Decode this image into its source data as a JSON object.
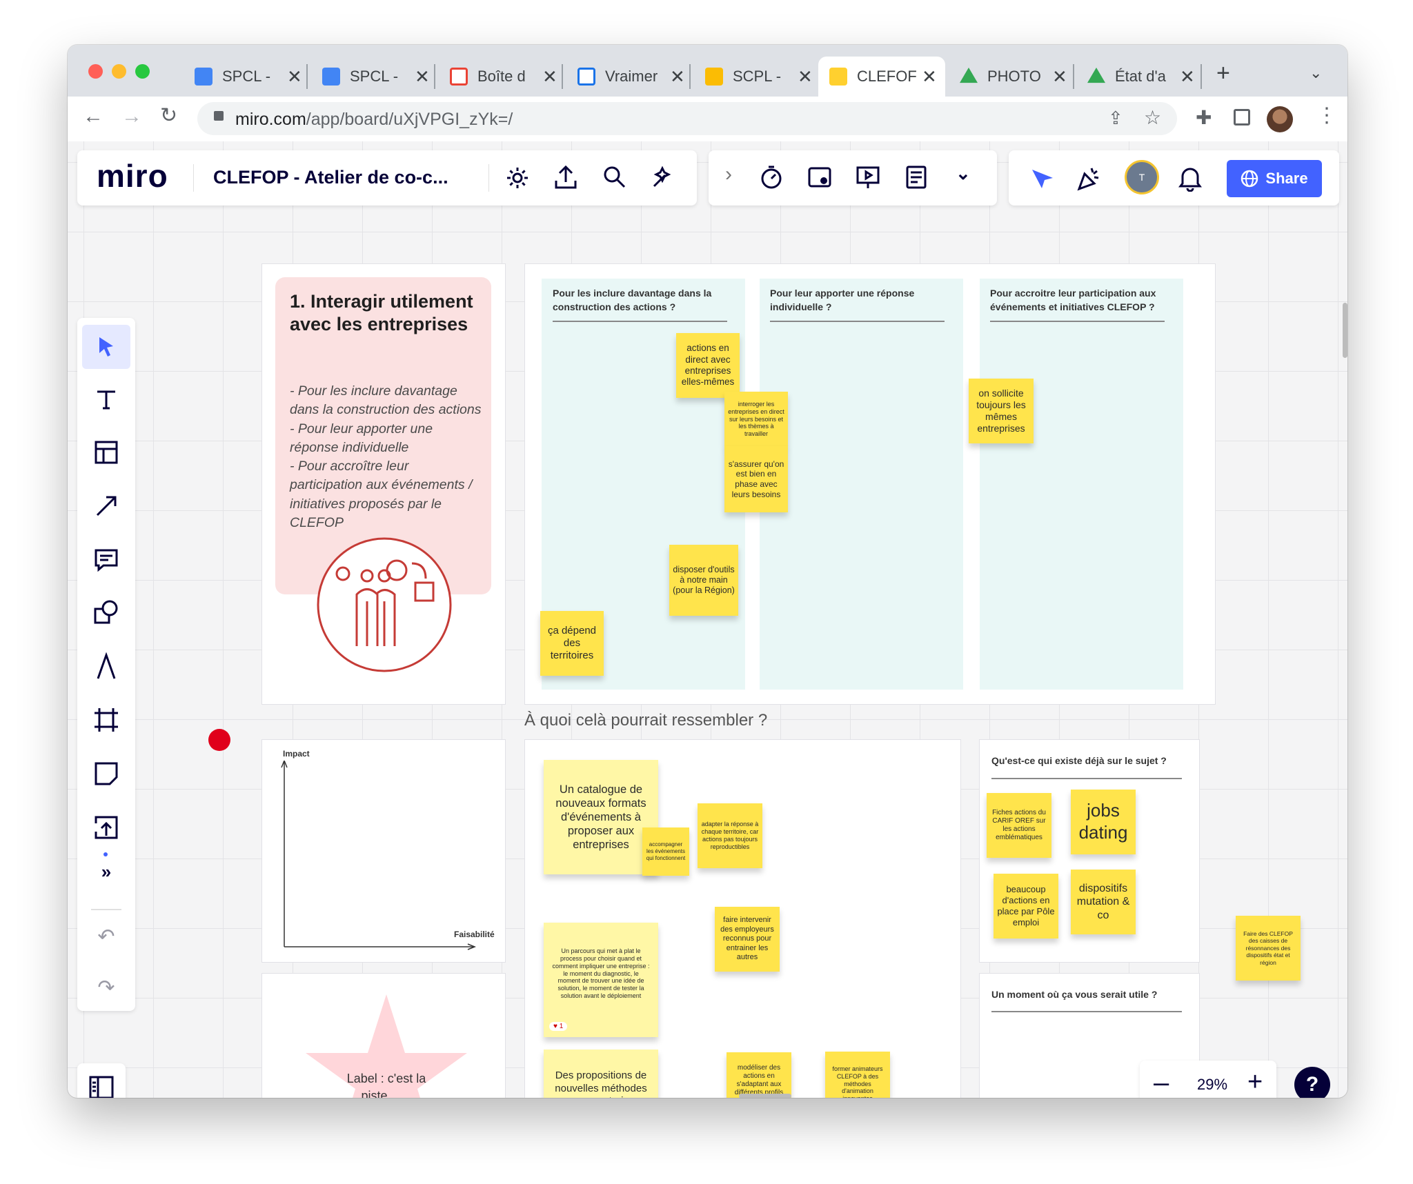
{
  "browser": {
    "tabs": [
      {
        "title": "SPCL - ",
        "favicon_color": "#4285f4"
      },
      {
        "title": "SPCL - ",
        "favicon_color": "#4285f4"
      },
      {
        "title": "Boîte d",
        "favicon_color": "#ea4335"
      },
      {
        "title": "Vraimer",
        "favicon_color": "#1a73e8"
      },
      {
        "title": "SCPL - ",
        "favicon_color": "#fbbc04"
      },
      {
        "title": "CLEFOF",
        "favicon_color": "#ffd02f",
        "active": true
      },
      {
        "title": "PHOTO",
        "favicon_color": "#34a853"
      },
      {
        "title": "État d'a",
        "favicon_color": "#34a853"
      }
    ],
    "url_host": "miro.com",
    "url_path": "/app/board/uXjVPGI_zYk=/"
  },
  "miro": {
    "logo": "miro",
    "board_title": "CLEFOP - Atelier de co-c...",
    "avatar_initial": "T",
    "share_label": "Share",
    "zoom_value": "29%",
    "help_label": "?",
    "accent_color": "#4262ff"
  },
  "board": {
    "intro_card": {
      "title": "1. Interagir utilement avec les entreprises",
      "lines": [
        "- Pour les inclure davantage dans la construction des actions",
        "- Pour leur apporter une réponse individuelle",
        "- Pour accroître leur participation aux événements / initiatives proposés par le CLEFOP"
      ]
    },
    "columns": [
      {
        "heading": "Pour les inclure davantage dans la construction des actions ?"
      },
      {
        "heading": "Pour leur apporter une réponse individuelle ?"
      },
      {
        "heading": "Pour accroitre leur participation aux événements et initiatives CLEFOP ?"
      }
    ],
    "stickies_top": [
      "actions en direct avec entreprises elles-mêmes",
      "interroger les entreprises en direct sur leurs besoins et les thèmes à travailler",
      "s'assurer qu'on est bien en phase avec leurs besoins",
      "disposer d'outils à notre main (pour la Région)",
      "ça dépend des territoires",
      "on sollicite toujours les mêmes entreprises"
    ],
    "section_caption": "À quoi celà pourrait ressembler ?",
    "matrix": {
      "ylabel": "Impact",
      "xlabel": "Faisabilité"
    },
    "star_label": "Label : c'est la piste ......",
    "stickies_ideas": [
      "Un catalogue de nouveaux formats d'événements à proposer aux entreprises",
      "accompagner les événements qui fonctionnent",
      "adapter la réponse à chaque territoire, car actions pas toujours reproductibles",
      "Un parcours qui met à plat le process pour choisir quand et comment impliquer une entreprise : le moment du diagnostic, le moment de trouver une idée de solution, le moment de tester la solution avant le déploiement",
      "faire intervenir des employeurs reconnus pour entrainer les autres",
      "Des propositions de nouvelles méthodes pour co-construire une action avec les entreprises",
      "modéliser des actions en s'adaptant aux différents profils d'entreprises",
      "former animateurs CLEFOP à des méthodes d'animation innovantes"
    ],
    "reaction_count": "1",
    "existing": {
      "heading": "Qu'est-ce qui existe déjà sur le sujet ?",
      "stickies": [
        "Fiches actions du CARIF OREF sur les actions emblématiques",
        "jobs dating",
        "beaucoup d'actions en place par Pôle emploi",
        "dispositifs mutation & co"
      ]
    },
    "useful": {
      "heading": "Un moment où ça vous serait utile ?"
    },
    "outside_sticky": "Faire des CLEFOP des caisses de résonnances des dispositifs état et région"
  }
}
